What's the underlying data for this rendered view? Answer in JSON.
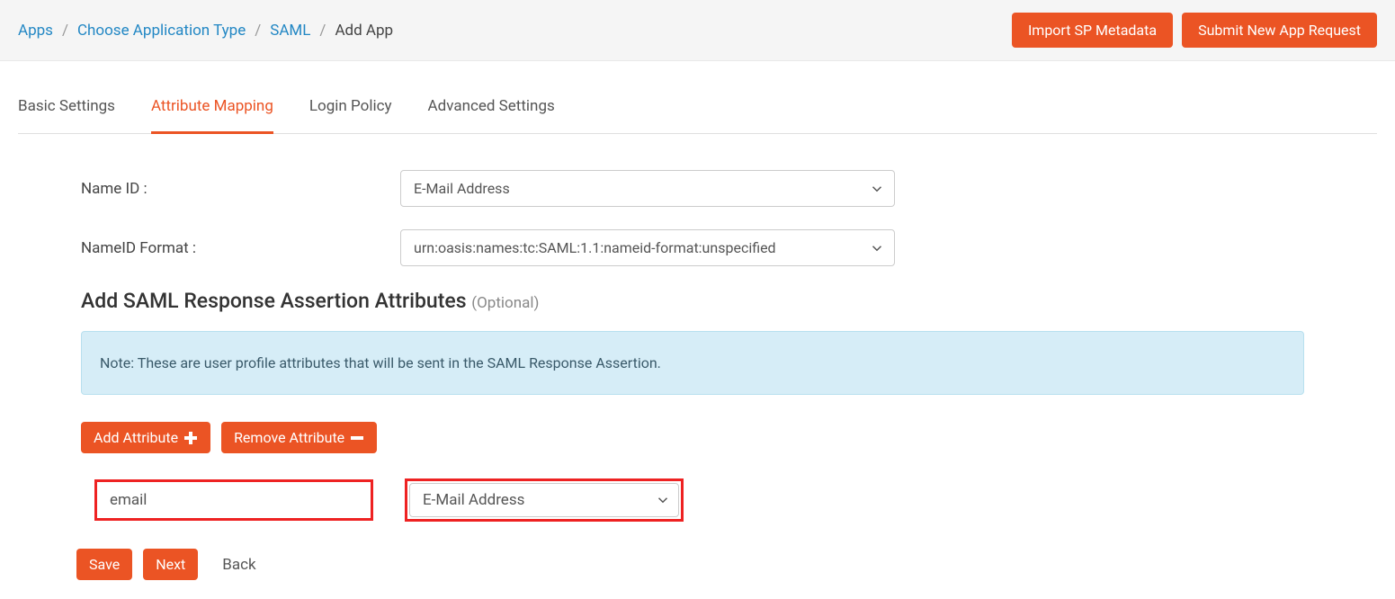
{
  "breadcrumb": {
    "apps": "Apps",
    "choose_type": "Choose Application Type",
    "saml": "SAML",
    "add_app": "Add App"
  },
  "header": {
    "import_metadata": "Import SP Metadata",
    "submit_request": "Submit New App Request"
  },
  "tabs": {
    "basic": "Basic Settings",
    "attr_mapping": "Attribute Mapping",
    "login_policy": "Login Policy",
    "advanced": "Advanced Settings"
  },
  "form": {
    "name_id_label": "Name ID :",
    "name_id_value": "E-Mail Address",
    "nameid_format_label": "NameID Format :",
    "nameid_format_value": "urn:oasis:names:tc:SAML:1.1:nameid-format:unspecified"
  },
  "section": {
    "heading": "Add SAML Response Assertion Attributes",
    "optional": "(Optional)",
    "note": "Note: These are user profile attributes that will be sent in the SAML Response Assertion."
  },
  "buttons": {
    "add_attr": "Add Attribute",
    "remove_attr": "Remove Attribute",
    "save": "Save",
    "next": "Next",
    "back": "Back"
  },
  "attribute_row": {
    "name": "email",
    "value": "E-Mail Address"
  }
}
